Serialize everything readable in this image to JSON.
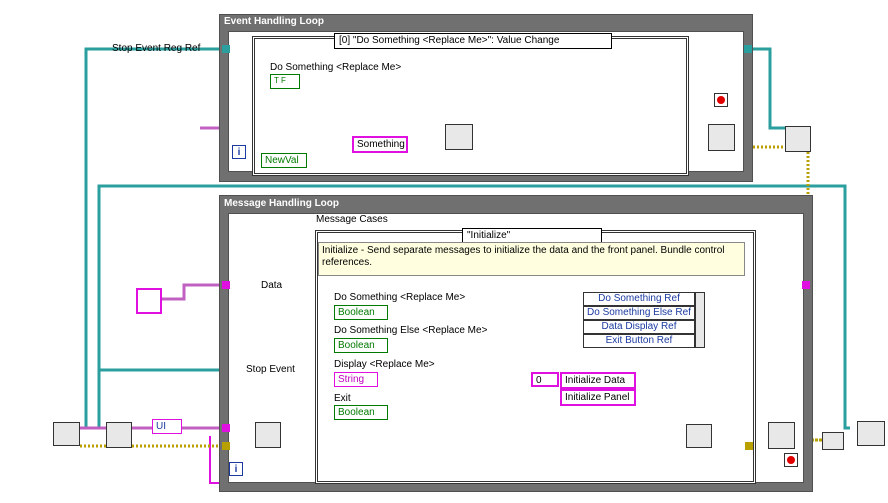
{
  "loops": {
    "event": {
      "title": "Event Handling Loop"
    },
    "message": {
      "title": "Message Handling Loop"
    }
  },
  "event_structure": {
    "selector": "[0] \"Do Something <Replace Me>\": Value Change",
    "control_label": "Do Something <Replace Me>",
    "bool_glyph": "T F",
    "newval_label": "NewVal",
    "string_constant": "Something"
  },
  "message_case": {
    "label": "Message Cases",
    "selector": "\"Initialize\"",
    "comment": "Initialize - Send separate messages to initialize the data and the front panel.  Bundle control references.",
    "controls": [
      {
        "label": "Do Something <Replace Me>",
        "type": "Boolean"
      },
      {
        "label": "Do Something Else <Replace Me>",
        "type": "Boolean"
      },
      {
        "label": "Display <Replace Me>",
        "type": "String"
      },
      {
        "label": "Exit",
        "type": "Boolean"
      }
    ],
    "bundle_refs": [
      "Do Something Ref",
      "Do Something Else Ref",
      "Data Display Ref",
      "Exit Button Ref"
    ],
    "array_index": "0",
    "array_items": [
      "Initialize Data",
      "Initialize Panel"
    ]
  },
  "wires": {
    "stop_event_reg_ref": "Stop Event Reg Ref",
    "data": "Data",
    "stop_event": "Stop Event",
    "ui_constant": "UI"
  },
  "iteration_terminal": "i",
  "colors": {
    "loop_frame": "#707070",
    "refnum_wire": "#2b9e9e",
    "string_wire": "#e010e0",
    "boolean_wire": "#007a00",
    "error_wire": "#b8a000",
    "cluster_wire": "#a04080",
    "label_blue": "#1a3aa0",
    "comment_bg": "#ffffe0"
  }
}
